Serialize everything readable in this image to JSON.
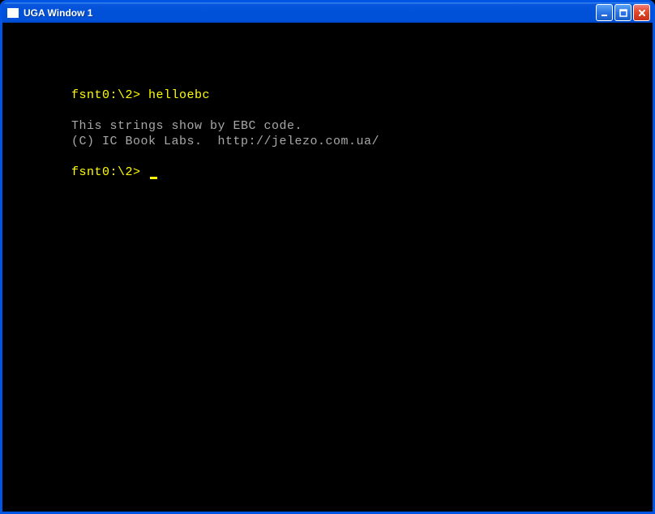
{
  "window": {
    "title": "UGA Window 1"
  },
  "terminal": {
    "line1": {
      "prompt": "fsnt0:\\2> ",
      "command": "helloebc"
    },
    "output1": "This strings show by EBC code.",
    "output2": "(C) IC Book Labs.  http://jelezo.com.ua/",
    "line2": {
      "prompt": "fsnt0:\\2> "
    }
  }
}
